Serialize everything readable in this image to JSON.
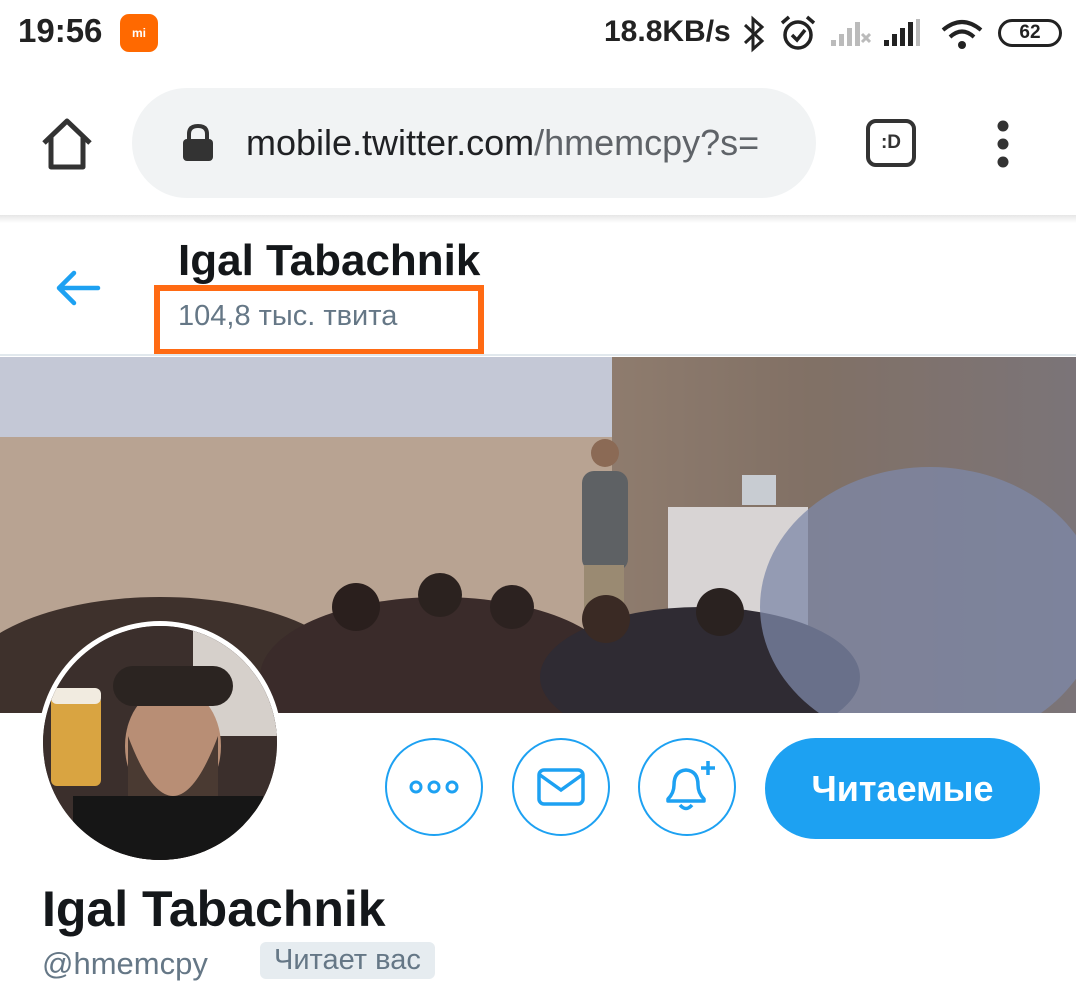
{
  "status_bar": {
    "time": "19:56",
    "app_icon": "mi",
    "network_speed": "18.8KB/s",
    "battery": "62",
    "icons": [
      "bluetooth-icon",
      "alarm-icon",
      "signal-weak-icon",
      "signal-icon",
      "wifi-icon",
      "battery-icon"
    ]
  },
  "browser": {
    "url_host": "mobile.twitter.com",
    "url_path": "/hmemcpy?s=",
    "icons": [
      "home-icon",
      "lock-icon",
      "tab-switcher-icon",
      "more-vert-icon"
    ]
  },
  "profile_header": {
    "name": "Igal Tabachnik",
    "tweet_count": "104,8 тыс. твита",
    "highlight_color": "#ff6a13"
  },
  "profile": {
    "name": "Igal Tabachnik",
    "handle": "@hmemcpy",
    "follows_you": "Читает вас",
    "follow_button": "Читаемые",
    "accent_color": "#1da1f2"
  }
}
